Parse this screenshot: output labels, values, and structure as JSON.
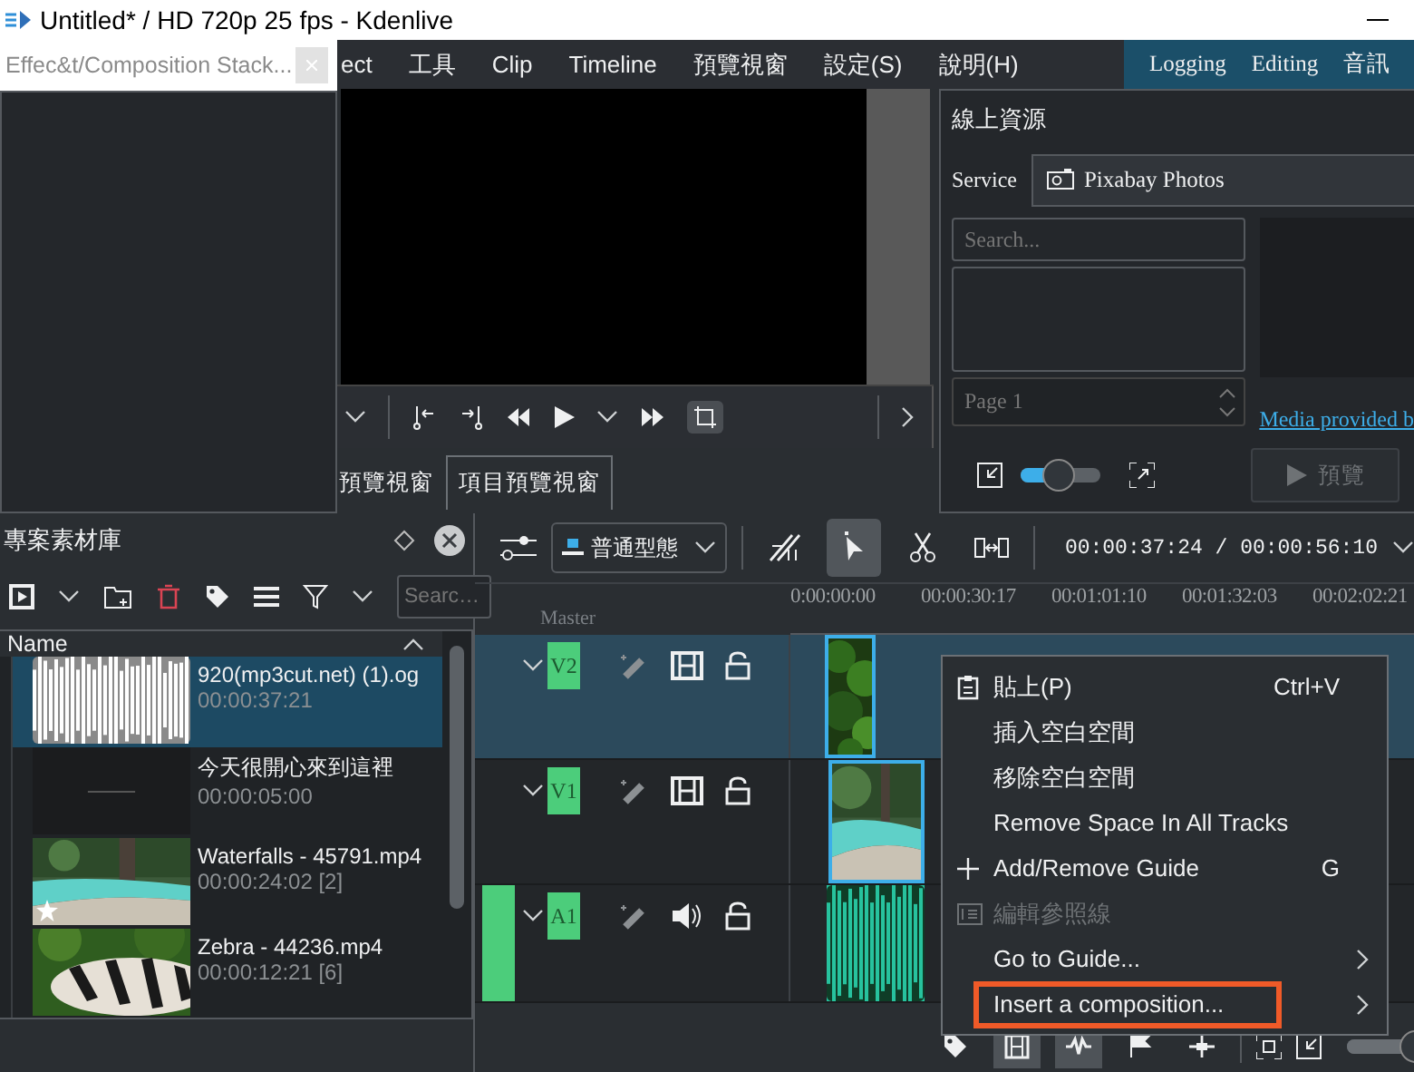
{
  "window": {
    "title": "Untitled* / HD 720p 25 fps - Kdenlive"
  },
  "effect_stack": {
    "title": "Effec&t/Composition Stack..."
  },
  "menu_bar": {
    "items": [
      "ect",
      "工具",
      "Clip",
      "Timeline",
      "預覽視窗",
      "設定(S)",
      "說明(H)"
    ],
    "layouts": [
      "Logging",
      "Editing",
      "音訊"
    ]
  },
  "monitor": {
    "tabs": [
      {
        "label": "預覽視窗",
        "selected": false
      },
      {
        "label": "項目預覽視窗",
        "selected": true
      }
    ]
  },
  "online_resources": {
    "title": "線上資源",
    "service_label": "Service",
    "service": "Pixabay Photos",
    "search_placeholder": "Search...",
    "page": "Page 1",
    "link": "Media provided b",
    "zoom": {
      "level": 0.45
    },
    "preview_button": {
      "label": "預覽",
      "disabled": true
    }
  },
  "project_bin": {
    "title": "專案素材庫",
    "search_placeholder": "Searc…",
    "column": "Name",
    "items": [
      {
        "name": "920(mp3cut.net) (1).og",
        "duration": "00:00:37:21",
        "kind": "audio",
        "selected": true,
        "starred": false
      },
      {
        "name": "今天很開心來到這裡",
        "duration": "00:00:05:00",
        "kind": "title",
        "selected": false,
        "starred": false
      },
      {
        "name": "Waterfalls - 45791.mp4",
        "duration": "00:00:24:02 [2]",
        "kind": "video",
        "selected": false,
        "starred": true
      },
      {
        "name": "Zebra - 44236.mp4",
        "duration": "00:00:12:21 [6]",
        "kind": "zebra",
        "selected": false,
        "starred": false
      }
    ]
  },
  "timeline": {
    "edit_mode": "普通型態",
    "tools": [
      {
        "selected": false
      },
      {
        "selected": true
      },
      {
        "selected": false
      },
      {
        "selected": false
      }
    ],
    "timecode": "00:00:37:24 / 00:00:56:10",
    "master_label": "Master",
    "ruler": [
      "0:00:00:00",
      "00:00:30:17",
      "00:01:01:10",
      "00:01:32:03",
      "00:02:02:21"
    ],
    "tracks": [
      {
        "name": "V2",
        "kind": "video",
        "selected": true,
        "audio_target": false
      },
      {
        "name": "V1",
        "kind": "video",
        "selected": false,
        "audio_target": false
      },
      {
        "name": "A1",
        "kind": "audio",
        "selected": false,
        "audio_target": true
      }
    ],
    "bottom_toolbar": [
      {
        "selected": false
      },
      {
        "selected": true
      },
      {
        "selected": true
      },
      {
        "selected": false
      },
      {
        "selected": false
      }
    ],
    "zoom": {
      "level": 0.68
    }
  },
  "context_menu": {
    "items": [
      {
        "label": "貼上(P)",
        "shortcut": "Ctrl+V",
        "disabled": false,
        "submenu": false,
        "highlighted": false
      },
      {
        "label": "插入空白空間",
        "disabled": false,
        "submenu": false,
        "highlighted": false
      },
      {
        "label": "移除空白空間",
        "disabled": false,
        "submenu": false,
        "highlighted": false
      },
      {
        "label": "Remove Space In All Tracks",
        "disabled": false,
        "submenu": false,
        "highlighted": false
      },
      {
        "label": "Add/Remove Guide",
        "shortcut": "G",
        "disabled": false,
        "submenu": false,
        "highlighted": false
      },
      {
        "label": "編輯參照線",
        "disabled": true,
        "submenu": false,
        "highlighted": false
      },
      {
        "label": "Go to Guide...",
        "disabled": false,
        "submenu": true,
        "highlighted": false
      },
      {
        "label": "Insert a composition...",
        "disabled": false,
        "submenu": true,
        "highlighted": true
      }
    ]
  }
}
